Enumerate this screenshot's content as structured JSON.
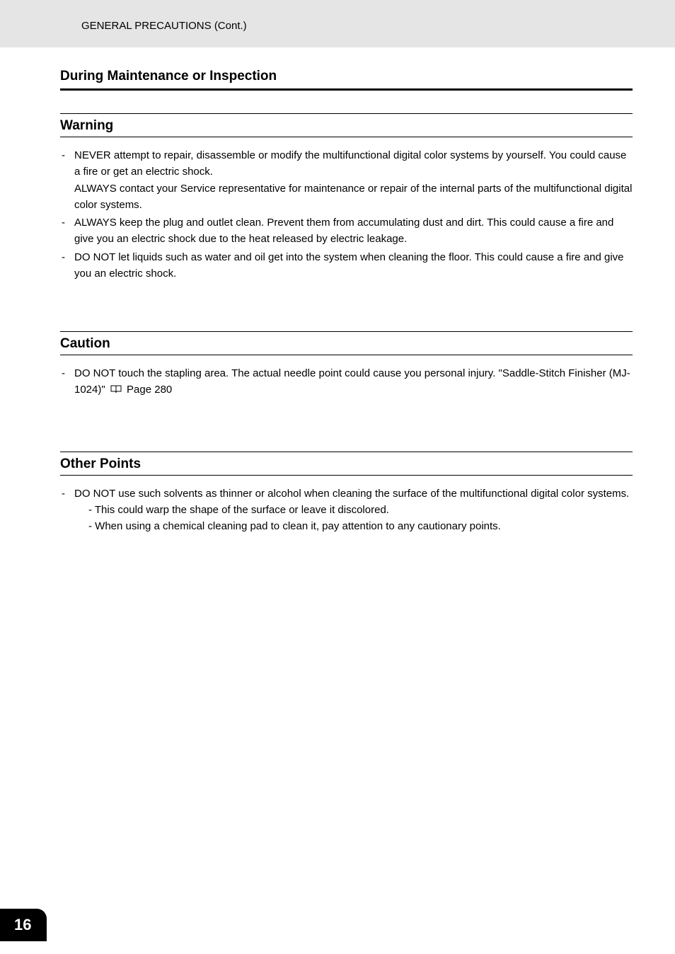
{
  "header": "GENERAL PRECAUTIONS (Cont.)",
  "section_title": "During Maintenance or Inspection",
  "warning": {
    "title": "Warning",
    "items": [
      {
        "text": "NEVER attempt to repair, disassemble or modify the multifunctional digital color systems by yourself. You could cause a fire or get an electric shock.",
        "cont": "ALWAYS contact your Service representative for maintenance or repair of the internal parts of the multifunctional digital color systems."
      },
      {
        "text": "ALWAYS keep the plug and outlet clean. Prevent them from accumulating dust and dirt. This could cause a fire and give you an electric shock due to the heat released by electric leakage."
      },
      {
        "text": "DO NOT let liquids such as water and oil get into the system when cleaning the floor. This could cause a fire and give you an electric shock."
      }
    ]
  },
  "caution": {
    "title": "Caution",
    "items": [
      {
        "text_before": "DO NOT touch the stapling area. The actual needle point could cause you personal injury. \"Saddle-Stitch Finisher (MJ-1024)\" ",
        "text_after": " Page 280"
      }
    ]
  },
  "other_points": {
    "title": "Other Points",
    "items": [
      {
        "text": "DO NOT use such solvents as thinner or alcohol when cleaning the surface of the multifunctional digital color systems.",
        "subs": [
          "- This could warp the shape of the surface or leave it discolored.",
          "- When using a chemical cleaning pad to clean it, pay attention to any cautionary points."
        ]
      }
    ]
  },
  "page_number": "16"
}
